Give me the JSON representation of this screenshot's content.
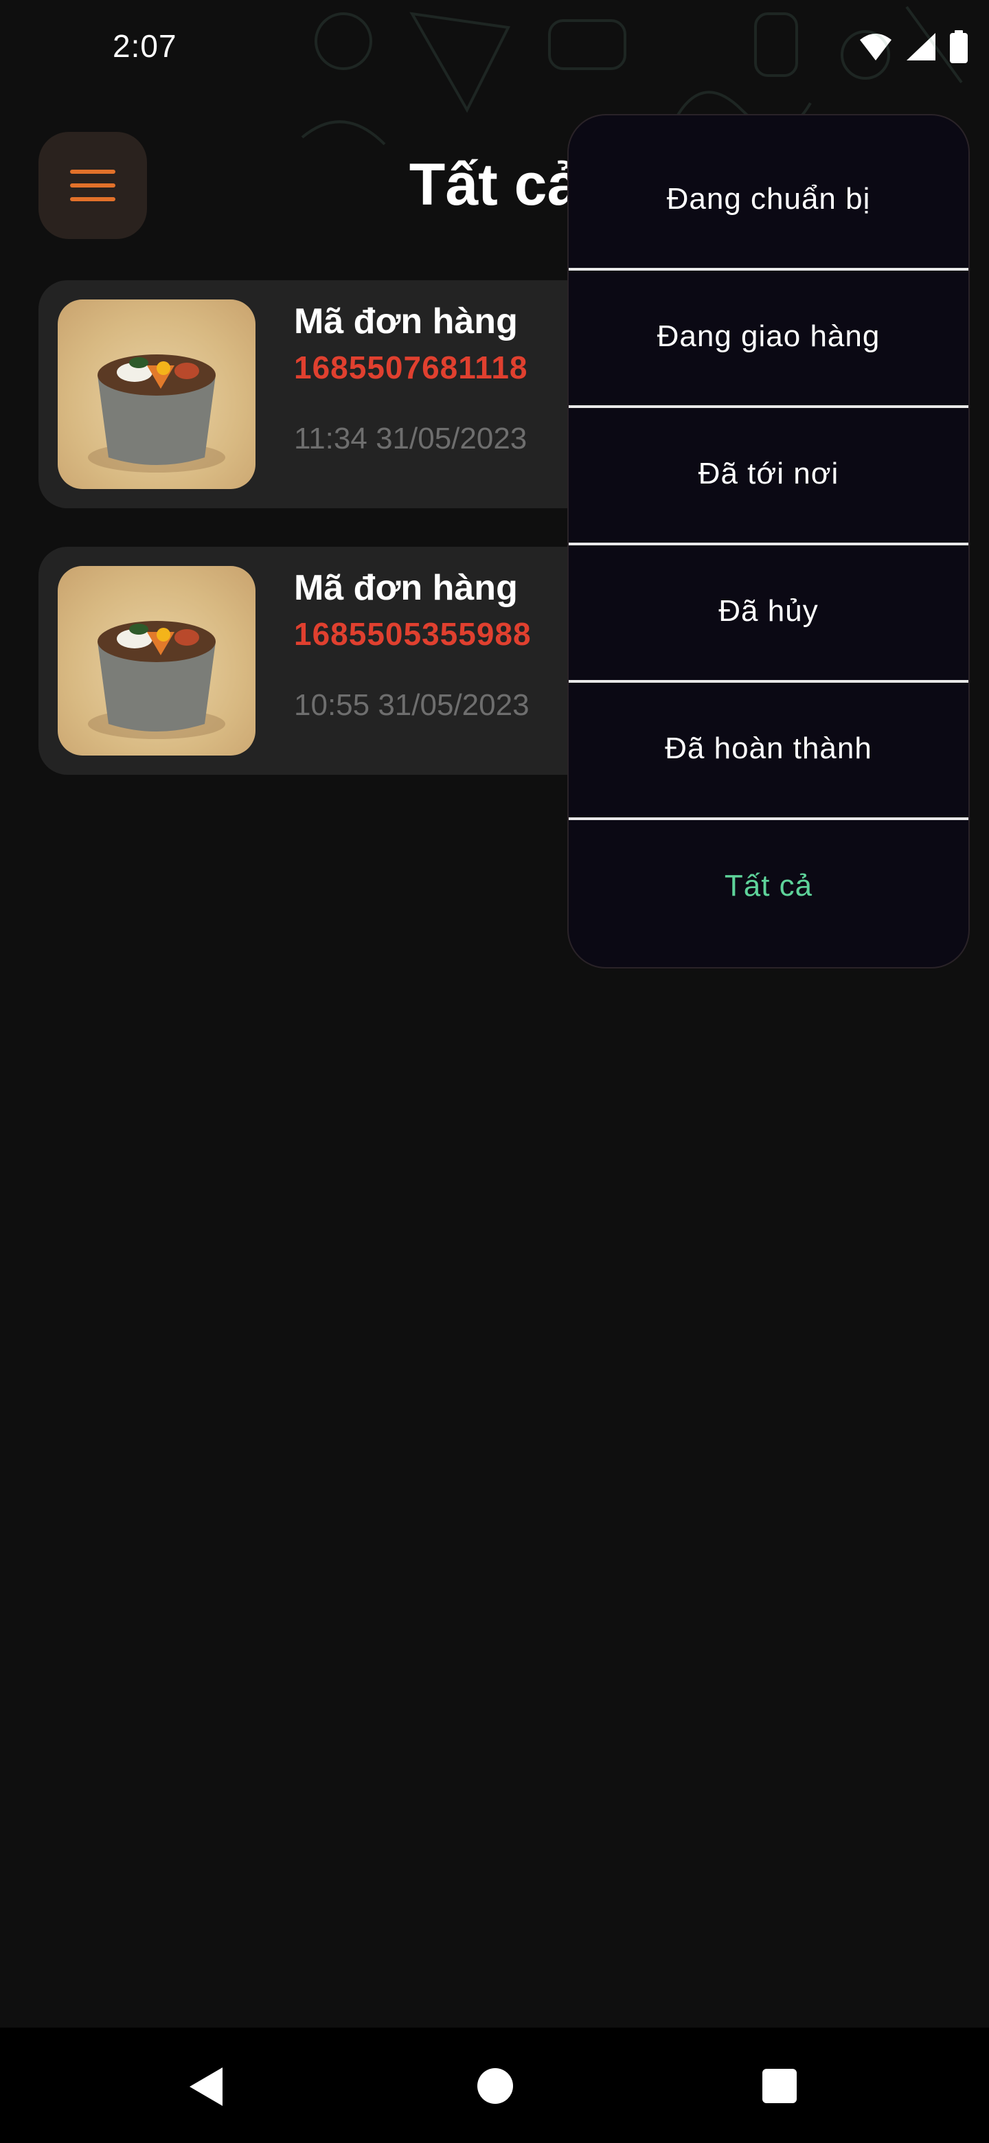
{
  "status_bar": {
    "time": "2:07"
  },
  "header": {
    "title": "Tất cả"
  },
  "orders": [
    {
      "label": "Mã đơn hàng",
      "id": "1685507681118",
      "time": "11:34 31/05/2023"
    },
    {
      "label": "Mã đơn hàng",
      "id": "1685505355988",
      "time": "10:55 31/05/2023"
    }
  ],
  "filter_menu": {
    "items": [
      {
        "label": "Đang chuẩn bị"
      },
      {
        "label": "Đang giao hàng"
      },
      {
        "label": "Đã tới nơi"
      },
      {
        "label": "Đã hủy"
      },
      {
        "label": "Đã hoàn thành"
      },
      {
        "label": "Tất cả"
      }
    ],
    "selected": "Tất cả"
  },
  "colors": {
    "background": "#0f0f0f",
    "card": "#232323",
    "order_id": "#e0402f",
    "menu_accent": "#e2712a",
    "active_filter": "#5ed39a"
  },
  "icons": {
    "menu": "hamburger-icon",
    "wifi": "wifi-icon",
    "signal": "signal-icon",
    "battery": "battery-icon",
    "back": "back-icon",
    "home": "home-icon",
    "recents": "recents-icon"
  }
}
